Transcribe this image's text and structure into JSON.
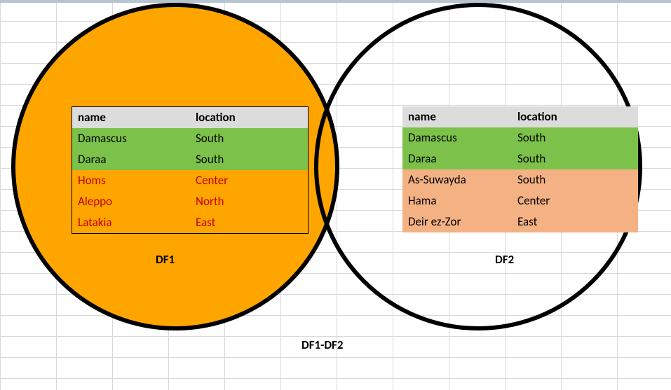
{
  "labels": {
    "df1": "DF1",
    "df2": "DF2",
    "caption": "DF1-DF2"
  },
  "tables": {
    "left": {
      "headers": [
        "name",
        "location"
      ],
      "rows": [
        {
          "cells": [
            "Damascus",
            "South"
          ],
          "cls": "green"
        },
        {
          "cells": [
            "Daraa",
            "South"
          ],
          "cls": "green"
        },
        {
          "cells": [
            "Homs",
            "Center"
          ],
          "cls": "orange"
        },
        {
          "cells": [
            "Aleppo",
            "North"
          ],
          "cls": "orange"
        },
        {
          "cells": [
            "Latakia",
            "East"
          ],
          "cls": "orange"
        }
      ]
    },
    "right": {
      "headers": [
        "name",
        "location"
      ],
      "rows": [
        {
          "cells": [
            "Damascus",
            "South"
          ],
          "cls": "green"
        },
        {
          "cells": [
            "Daraa",
            "South"
          ],
          "cls": "green"
        },
        {
          "cells": [
            "As-Suwayda",
            "South"
          ],
          "cls": "peach"
        },
        {
          "cells": [
            "Hama",
            "Center"
          ],
          "cls": "peach"
        },
        {
          "cells": [
            "Deir ez-Zor",
            "East"
          ],
          "cls": "peach"
        }
      ]
    }
  }
}
